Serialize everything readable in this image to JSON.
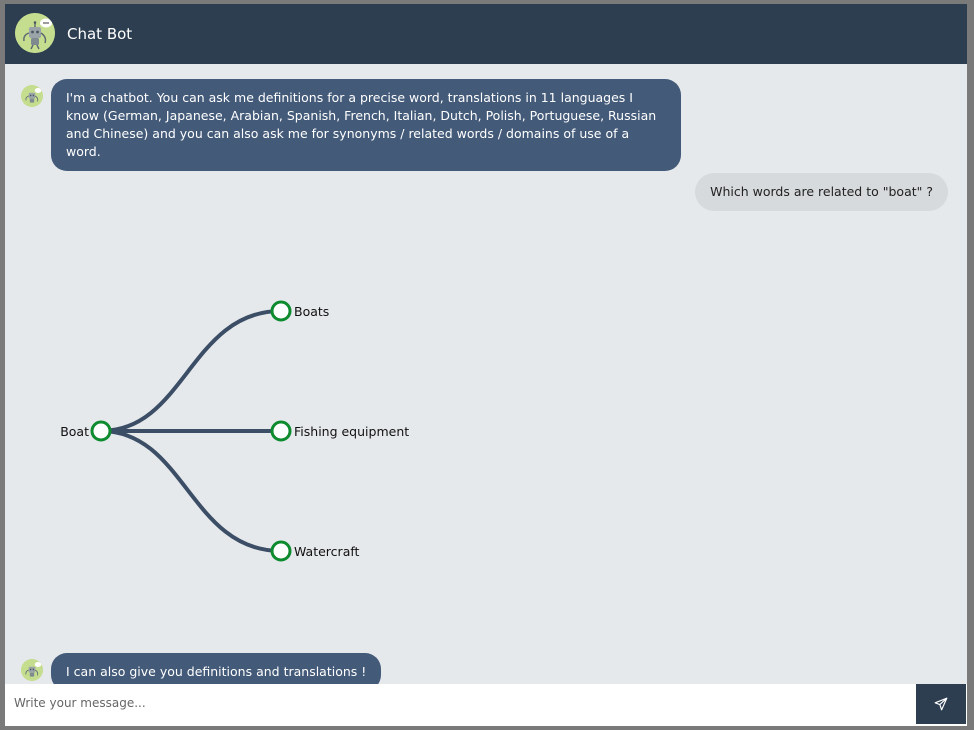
{
  "header": {
    "title": "Chat Bot",
    "avatar_icon": "robot-icon"
  },
  "messages": [
    {
      "from": "bot",
      "text": "I'm a chatbot. You can ask me definitions for a precise word, translations in 11 languages I know (German, Japanese, Arabian, Spanish, French, Italian, Dutch, Polish, Portuguese, Russian and Chinese) and you can also ask me for synonyms / related words / domains of use of a word."
    },
    {
      "from": "user",
      "text": "Which words are related to \"boat\" ?"
    },
    {
      "from": "bot",
      "text": "I can also give you definitions and translations !"
    }
  ],
  "tree": {
    "root": "Boat",
    "children": [
      "Boats",
      "Fishing equipment",
      "Watercraft"
    ]
  },
  "composer": {
    "placeholder": "Write your message...",
    "send_icon": "send-icon"
  },
  "colors": {
    "header_bg": "#2c3e50",
    "bot_bubble": "#435a79",
    "user_bubble": "#d7dadc",
    "chat_bg": "#e6e9ec",
    "tree_link": "#3b4e66",
    "tree_node": "#0e8a2f",
    "avatar_bg": "#c5dd8f"
  }
}
